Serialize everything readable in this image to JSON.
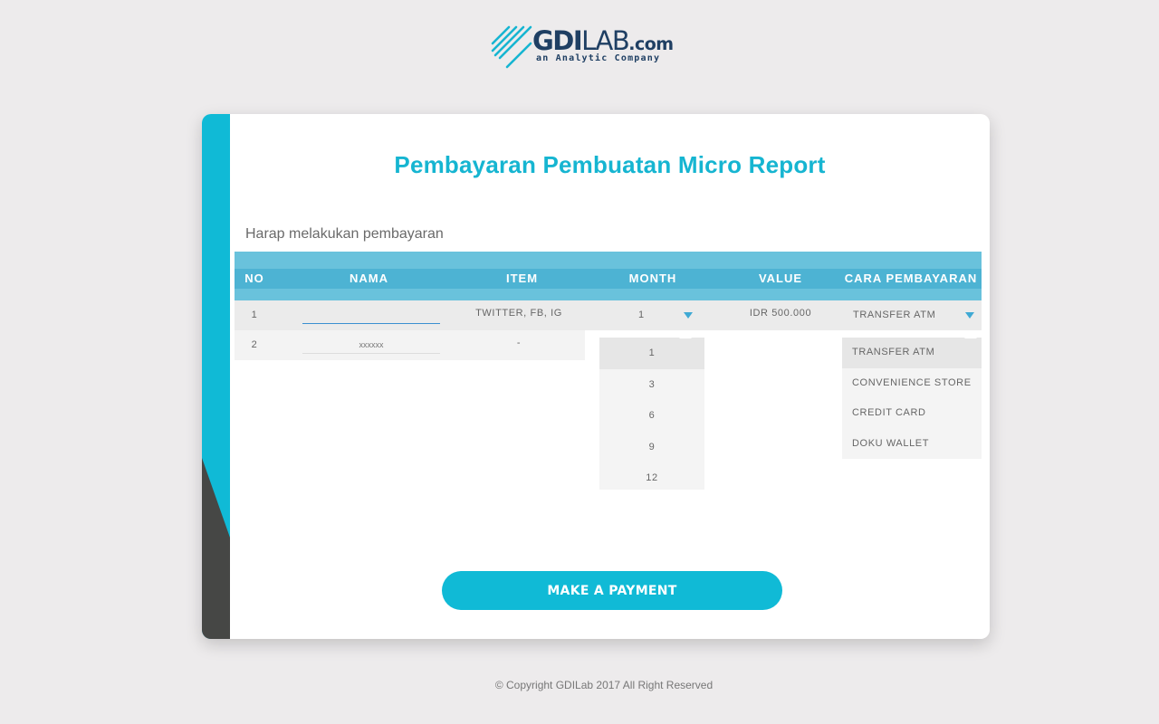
{
  "brand": {
    "name_bold": "GDI",
    "name_thin": "LAB",
    "name_domain": ".com",
    "tagline": "an Analytic Company",
    "colors": {
      "primary": "#1f3f63",
      "accent": "#16b5d1"
    }
  },
  "page": {
    "title": "Pembayaran Pembuatan Micro Report",
    "subtitle": "Harap melakukan pembayaran"
  },
  "table": {
    "headers": [
      "NO",
      "NAMA",
      "ITEM",
      "MONTH",
      "VALUE",
      "CARA PEMBAYARAN"
    ],
    "rows": [
      {
        "no": "1",
        "nama_value": "",
        "item": "TWITTER, FB, IG",
        "month": "1",
        "value": "IDR 500.000",
        "payment": "TRANSFER ATM"
      },
      {
        "no": "2",
        "nama_placeholder": "xxxxxx",
        "item": "-"
      }
    ]
  },
  "month_options": [
    "1",
    "3",
    "6",
    "9",
    "12"
  ],
  "month_selected": "1",
  "payment_options": [
    "TRANSFER ATM",
    "CONVENIENCE STORE",
    "CREDIT CARD",
    "DOKU WALLET"
  ],
  "payment_selected": "TRANSFER ATM",
  "actions": {
    "pay_label": "MAKE A PAYMENT"
  },
  "footer": {
    "copyright": "© Copyright GDILab 2017 All Right Reserved"
  },
  "icons": {
    "month_caret": "caret-down-icon",
    "payment_caret": "caret-down-icon",
    "logo": "stripes-logo-icon"
  }
}
